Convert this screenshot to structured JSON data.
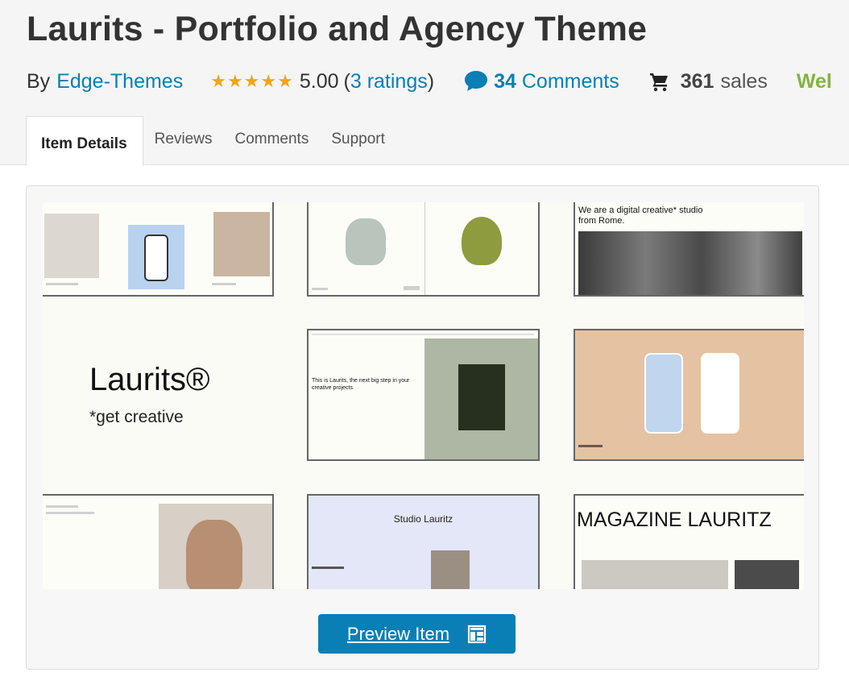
{
  "page": {
    "title": "Laurits - Portfolio and Agency Theme"
  },
  "meta": {
    "by_label": "By",
    "author": "Edge-Themes",
    "stars": "★★★★★",
    "rating_value": "5.00",
    "rating_open": "(",
    "rating_count_text": "3 ratings",
    "rating_close": ")",
    "comments_count": "34",
    "comments_label": "Comments",
    "sales_count": "361",
    "sales_label": "sales",
    "extra_badge": "Wel"
  },
  "tabs": [
    {
      "label": "Item Details",
      "active": true
    },
    {
      "label": "Reviews"
    },
    {
      "label": "Comments"
    },
    {
      "label": "Support"
    }
  ],
  "preview": {
    "brand_name": "Laurits®",
    "tagline": "*get creative",
    "thumb_digital_text": "We are a digital creative* studio from Rome.",
    "thumb_intro_text": "This is Laurits, the next big step in your creative projects",
    "thumb_studio_text": "Studio Lauritz",
    "thumb_magazine_text": "MAGAZINE LAURITZ"
  },
  "actions": {
    "preview_label": "Preview Item"
  },
  "colors": {
    "link": "#0a7fb5",
    "stars": "#f3a414",
    "accent_green": "#82b440",
    "button": "#0a7fb5"
  }
}
